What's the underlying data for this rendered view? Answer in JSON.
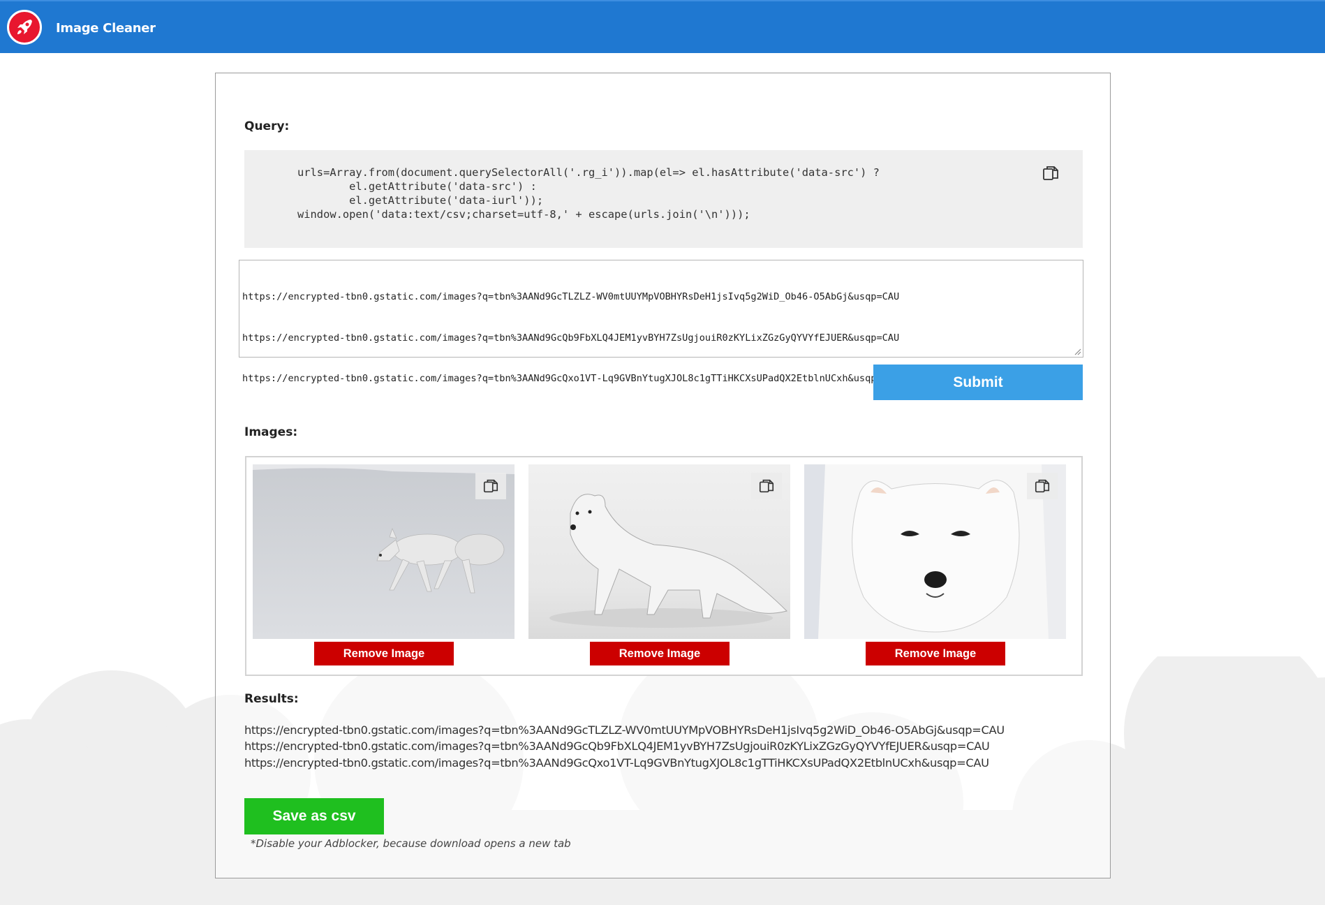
{
  "header": {
    "title": "Image Cleaner",
    "logo_icon": "rocket-icon",
    "bar_color": "#1f78d1",
    "logo_color": "#e8172f"
  },
  "query": {
    "label": "Query:",
    "code": "urls=Array.from(document.querySelectorAll('.rg_i')).map(el=> el.hasAttribute('data-src') ?\n        el.getAttribute('data-src') :\n        el.getAttribute('data-iurl'));\nwindow.open('data:text/csv;charset=utf-8,' + escape(urls.join('\\n')));",
    "copy_icon": "copy-icon"
  },
  "input": {
    "urls": [
      "https://encrypted-tbn0.gstatic.com/images?q=tbn%3AANd9GcTLZLZ-WV0mtUUYMpVOBHYRsDeH1jsIvq5g2WiD_Ob46-O5AbGj&usqp=CAU",
      "https://encrypted-tbn0.gstatic.com/images?q=tbn%3AANd9GcQb9FbXLQ4JEM1yvBYH7ZsUgjouiR0zKYLixZGzGyQYVYfEJUER&usqp=CAU",
      "https://encrypted-tbn0.gstatic.com/images?q=tbn%3AANd9GcQxo1VT-Lq9GVBnYtugXJOL8c1gTTiHKCXsUPadQX2EtblnUCxh&usqp=CAU"
    ]
  },
  "submit": {
    "label": "Submit",
    "color": "#3ba0e6"
  },
  "images": {
    "label": "Images:",
    "items": [
      {
        "alt": "arctic fox walking on snow",
        "remove_label": "Remove Image",
        "copy_icon": "copy-icon"
      },
      {
        "alt": "white arctic fox figurine",
        "remove_label": "Remove Image",
        "copy_icon": "copy-icon"
      },
      {
        "alt": "white arctic fox face close-up",
        "remove_label": "Remove Image",
        "copy_icon": "copy-icon"
      }
    ],
    "remove_color": "#cc0000"
  },
  "results": {
    "label": "Results:",
    "text": "https://encrypted-tbn0.gstatic.com/images?q=tbn%3AANd9GcTLZLZ-WV0mtUUYMpVOBHYRsDeH1jsIvq5g2WiD_Ob46-O5AbGj&usqp=CAU\nhttps://encrypted-tbn0.gstatic.com/images?q=tbn%3AANd9GcQb9FbXLQ4JEM1yvBYH7ZsUgjouiR0zKYLixZGzGyQYVYfEJUER&usqp=CAU\nhttps://encrypted-tbn0.gstatic.com/images?q=tbn%3AANd9GcQxo1VT-Lq9GVBnYtugXJOL8c1gTTiHKCXsUPadQX2EtblnUCxh&usqp=CAU"
  },
  "save": {
    "label": "Save as csv",
    "color": "#1fbf1f"
  },
  "note": "*Disable your Adblocker, because download opens a new tab"
}
